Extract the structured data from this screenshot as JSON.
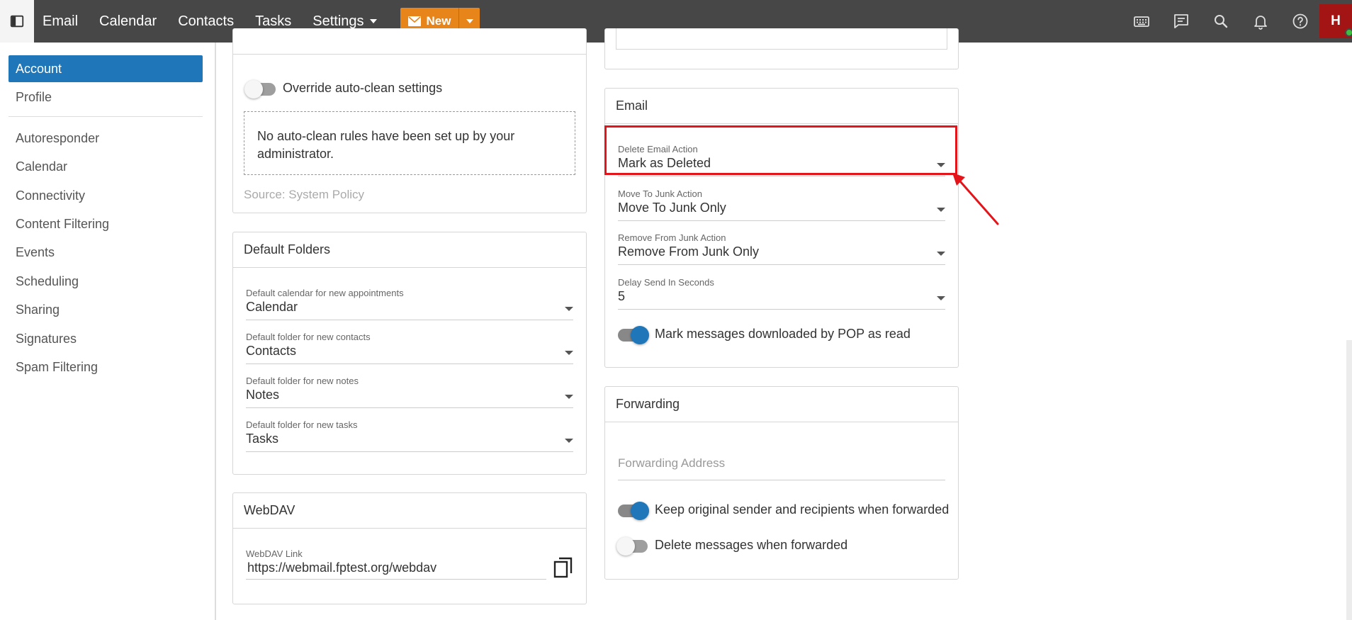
{
  "topbar": {
    "nav": [
      "Email",
      "Calendar",
      "Contacts",
      "Tasks",
      "Settings"
    ],
    "new_label": "New",
    "avatar_initial": "H"
  },
  "leftnav": {
    "items": [
      "Account",
      "Profile",
      "Autoresponder",
      "Calendar",
      "Connectivity",
      "Content Filtering",
      "Events",
      "Scheduling",
      "Sharing",
      "Signatures",
      "Spam Filtering"
    ]
  },
  "autoclean": {
    "override_label": "Override auto-clean settings",
    "message": "No auto-clean rules have been set up by your administrator.",
    "source": "Source: System Policy"
  },
  "default_folders": {
    "title": "Default Folders",
    "fields": [
      {
        "label": "Default calendar for new appointments",
        "value": "Calendar"
      },
      {
        "label": "Default folder for new contacts",
        "value": "Contacts"
      },
      {
        "label": "Default folder for new notes",
        "value": "Notes"
      },
      {
        "label": "Default folder for new tasks",
        "value": "Tasks"
      }
    ]
  },
  "webdav": {
    "title": "WebDAV",
    "link_label": "WebDAV Link",
    "link_value": "https://webmail.fptest.org/webdav"
  },
  "email": {
    "title": "Email",
    "fields": [
      {
        "label": "Delete Email Action",
        "value": "Mark as Deleted"
      },
      {
        "label": "Move To Junk Action",
        "value": "Move To Junk Only"
      },
      {
        "label": "Remove From Junk Action",
        "value": "Remove From Junk Only"
      },
      {
        "label": "Delay Send In Seconds",
        "value": "5"
      }
    ],
    "pop_toggle_label": "Mark messages downloaded by POP as read",
    "pop_toggle_on": true
  },
  "forwarding": {
    "title": "Forwarding",
    "address_placeholder": "Forwarding Address",
    "keep_label": "Keep original sender and recipients when forwarded",
    "keep_on": true,
    "delete_label": "Delete messages when forwarded",
    "delete_on": false
  },
  "colors": {
    "accent": "#1f76b8",
    "new_button": "#e8851a",
    "topbar": "#474747",
    "highlight": "#e3141a"
  }
}
